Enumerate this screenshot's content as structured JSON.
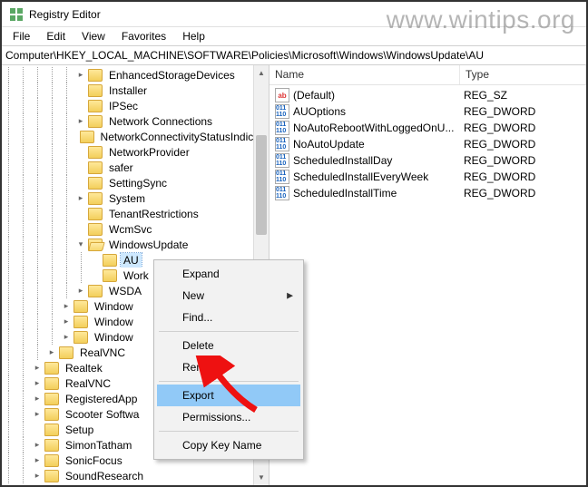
{
  "window": {
    "title": "Registry Editor"
  },
  "menubar": [
    "File",
    "Edit",
    "View",
    "Favorites",
    "Help"
  ],
  "address": "Computer\\HKEY_LOCAL_MACHINE\\SOFTWARE\\Policies\\Microsoft\\Windows\\WindowsUpdate\\AU",
  "tree": [
    {
      "depth": 5,
      "exp": "closed",
      "name": "EnhancedStorageDevices"
    },
    {
      "depth": 5,
      "exp": "none",
      "name": "Installer"
    },
    {
      "depth": 5,
      "exp": "none",
      "name": "IPSec"
    },
    {
      "depth": 5,
      "exp": "closed",
      "name": "Network Connections"
    },
    {
      "depth": 5,
      "exp": "none",
      "name": "NetworkConnectivityStatusIndicato"
    },
    {
      "depth": 5,
      "exp": "none",
      "name": "NetworkProvider"
    },
    {
      "depth": 5,
      "exp": "none",
      "name": "safer"
    },
    {
      "depth": 5,
      "exp": "none",
      "name": "SettingSync"
    },
    {
      "depth": 5,
      "exp": "closed",
      "name": "System"
    },
    {
      "depth": 5,
      "exp": "none",
      "name": "TenantRestrictions"
    },
    {
      "depth": 5,
      "exp": "none",
      "name": "WcmSvc"
    },
    {
      "depth": 5,
      "exp": "open",
      "name": "WindowsUpdate"
    },
    {
      "depth": 6,
      "exp": "none",
      "name": "AU",
      "selected": true
    },
    {
      "depth": 6,
      "exp": "none",
      "name": "Work"
    },
    {
      "depth": 5,
      "exp": "closed",
      "name": "WSDA"
    },
    {
      "depth": 4,
      "exp": "closed",
      "name": "Window"
    },
    {
      "depth": 4,
      "exp": "closed",
      "name": "Window"
    },
    {
      "depth": 4,
      "exp": "closed",
      "name": "Window"
    },
    {
      "depth": 3,
      "exp": "closed",
      "name": "RealVNC"
    },
    {
      "depth": 2,
      "exp": "closed",
      "name": "Realtek"
    },
    {
      "depth": 2,
      "exp": "closed",
      "name": "RealVNC"
    },
    {
      "depth": 2,
      "exp": "closed",
      "name": "RegisteredApp"
    },
    {
      "depth": 2,
      "exp": "closed",
      "name": "Scooter Softwa"
    },
    {
      "depth": 2,
      "exp": "none",
      "name": "Setup"
    },
    {
      "depth": 2,
      "exp": "closed",
      "name": "SimonTatham"
    },
    {
      "depth": 2,
      "exp": "closed",
      "name": "SonicFocus"
    },
    {
      "depth": 2,
      "exp": "closed",
      "name": "SoundResearch"
    }
  ],
  "list": {
    "headers": {
      "name": "Name",
      "type": "Type"
    },
    "rows": [
      {
        "icon": "str",
        "name": "(Default)",
        "type": "REG_SZ"
      },
      {
        "icon": "num",
        "name": "AUOptions",
        "type": "REG_DWORD"
      },
      {
        "icon": "num",
        "name": "NoAutoRebootWithLoggedOnU...",
        "type": "REG_DWORD"
      },
      {
        "icon": "num",
        "name": "NoAutoUpdate",
        "type": "REG_DWORD"
      },
      {
        "icon": "num",
        "name": "ScheduledInstallDay",
        "type": "REG_DWORD"
      },
      {
        "icon": "num",
        "name": "ScheduledInstallEveryWeek",
        "type": "REG_DWORD"
      },
      {
        "icon": "num",
        "name": "ScheduledInstallTime",
        "type": "REG_DWORD"
      }
    ]
  },
  "contextmenu": {
    "items": [
      {
        "label": "Expand"
      },
      {
        "label": "New",
        "submenu": true
      },
      {
        "label": "Find..."
      },
      {
        "sep": true
      },
      {
        "label": "Delete"
      },
      {
        "label": "Rename"
      },
      {
        "sep": true
      },
      {
        "label": "Export",
        "highlight": true
      },
      {
        "label": "Permissions..."
      },
      {
        "sep": true
      },
      {
        "label": "Copy Key Name"
      }
    ]
  },
  "watermark": "www.wintips.org"
}
